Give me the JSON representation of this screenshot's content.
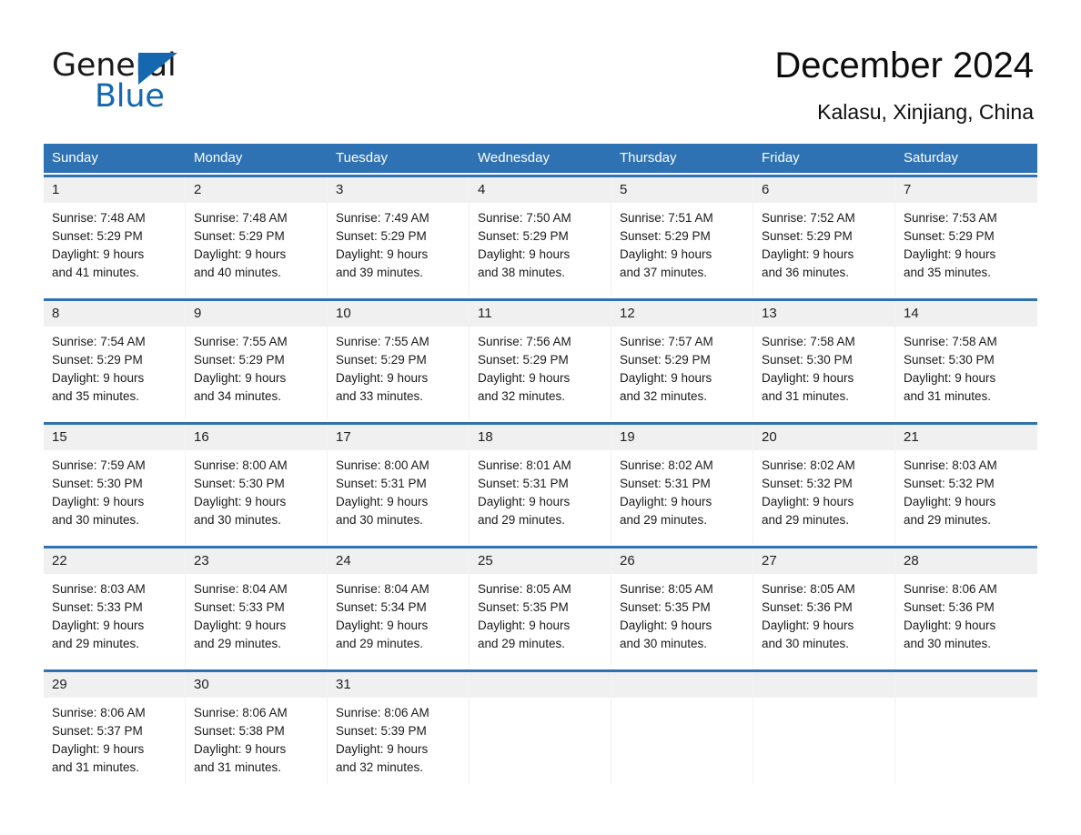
{
  "brand": {
    "name_part1": "General",
    "name_part2": "Blue",
    "logo_icon": "triangle-logo-icon"
  },
  "header": {
    "title": "December 2024",
    "location": "Kalasu, Xinjiang, China"
  },
  "colors": {
    "header_blue": "#2f72b3",
    "brand_blue": "#1567b0",
    "day_band": "#f0f0f0",
    "text": "#1a1a1a"
  },
  "weekdays": [
    "Sunday",
    "Monday",
    "Tuesday",
    "Wednesday",
    "Thursday",
    "Friday",
    "Saturday"
  ],
  "weeks": [
    {
      "days": [
        {
          "date": "1",
          "sunrise": "Sunrise: 7:48 AM",
          "sunset": "Sunset: 5:29 PM",
          "daylight_line1": "Daylight: 9 hours",
          "daylight_line2": "and 41 minutes."
        },
        {
          "date": "2",
          "sunrise": "Sunrise: 7:48 AM",
          "sunset": "Sunset: 5:29 PM",
          "daylight_line1": "Daylight: 9 hours",
          "daylight_line2": "and 40 minutes."
        },
        {
          "date": "3",
          "sunrise": "Sunrise: 7:49 AM",
          "sunset": "Sunset: 5:29 PM",
          "daylight_line1": "Daylight: 9 hours",
          "daylight_line2": "and 39 minutes."
        },
        {
          "date": "4",
          "sunrise": "Sunrise: 7:50 AM",
          "sunset": "Sunset: 5:29 PM",
          "daylight_line1": "Daylight: 9 hours",
          "daylight_line2": "and 38 minutes."
        },
        {
          "date": "5",
          "sunrise": "Sunrise: 7:51 AM",
          "sunset": "Sunset: 5:29 PM",
          "daylight_line1": "Daylight: 9 hours",
          "daylight_line2": "and 37 minutes."
        },
        {
          "date": "6",
          "sunrise": "Sunrise: 7:52 AM",
          "sunset": "Sunset: 5:29 PM",
          "daylight_line1": "Daylight: 9 hours",
          "daylight_line2": "and 36 minutes."
        },
        {
          "date": "7",
          "sunrise": "Sunrise: 7:53 AM",
          "sunset": "Sunset: 5:29 PM",
          "daylight_line1": "Daylight: 9 hours",
          "daylight_line2": "and 35 minutes."
        }
      ]
    },
    {
      "days": [
        {
          "date": "8",
          "sunrise": "Sunrise: 7:54 AM",
          "sunset": "Sunset: 5:29 PM",
          "daylight_line1": "Daylight: 9 hours",
          "daylight_line2": "and 35 minutes."
        },
        {
          "date": "9",
          "sunrise": "Sunrise: 7:55 AM",
          "sunset": "Sunset: 5:29 PM",
          "daylight_line1": "Daylight: 9 hours",
          "daylight_line2": "and 34 minutes."
        },
        {
          "date": "10",
          "sunrise": "Sunrise: 7:55 AM",
          "sunset": "Sunset: 5:29 PM",
          "daylight_line1": "Daylight: 9 hours",
          "daylight_line2": "and 33 minutes."
        },
        {
          "date": "11",
          "sunrise": "Sunrise: 7:56 AM",
          "sunset": "Sunset: 5:29 PM",
          "daylight_line1": "Daylight: 9 hours",
          "daylight_line2": "and 32 minutes."
        },
        {
          "date": "12",
          "sunrise": "Sunrise: 7:57 AM",
          "sunset": "Sunset: 5:29 PM",
          "daylight_line1": "Daylight: 9 hours",
          "daylight_line2": "and 32 minutes."
        },
        {
          "date": "13",
          "sunrise": "Sunrise: 7:58 AM",
          "sunset": "Sunset: 5:30 PM",
          "daylight_line1": "Daylight: 9 hours",
          "daylight_line2": "and 31 minutes."
        },
        {
          "date": "14",
          "sunrise": "Sunrise: 7:58 AM",
          "sunset": "Sunset: 5:30 PM",
          "daylight_line1": "Daylight: 9 hours",
          "daylight_line2": "and 31 minutes."
        }
      ]
    },
    {
      "days": [
        {
          "date": "15",
          "sunrise": "Sunrise: 7:59 AM",
          "sunset": "Sunset: 5:30 PM",
          "daylight_line1": "Daylight: 9 hours",
          "daylight_line2": "and 30 minutes."
        },
        {
          "date": "16",
          "sunrise": "Sunrise: 8:00 AM",
          "sunset": "Sunset: 5:30 PM",
          "daylight_line1": "Daylight: 9 hours",
          "daylight_line2": "and 30 minutes."
        },
        {
          "date": "17",
          "sunrise": "Sunrise: 8:00 AM",
          "sunset": "Sunset: 5:31 PM",
          "daylight_line1": "Daylight: 9 hours",
          "daylight_line2": "and 30 minutes."
        },
        {
          "date": "18",
          "sunrise": "Sunrise: 8:01 AM",
          "sunset": "Sunset: 5:31 PM",
          "daylight_line1": "Daylight: 9 hours",
          "daylight_line2": "and 29 minutes."
        },
        {
          "date": "19",
          "sunrise": "Sunrise: 8:02 AM",
          "sunset": "Sunset: 5:31 PM",
          "daylight_line1": "Daylight: 9 hours",
          "daylight_line2": "and 29 minutes."
        },
        {
          "date": "20",
          "sunrise": "Sunrise: 8:02 AM",
          "sunset": "Sunset: 5:32 PM",
          "daylight_line1": "Daylight: 9 hours",
          "daylight_line2": "and 29 minutes."
        },
        {
          "date": "21",
          "sunrise": "Sunrise: 8:03 AM",
          "sunset": "Sunset: 5:32 PM",
          "daylight_line1": "Daylight: 9 hours",
          "daylight_line2": "and 29 minutes."
        }
      ]
    },
    {
      "days": [
        {
          "date": "22",
          "sunrise": "Sunrise: 8:03 AM",
          "sunset": "Sunset: 5:33 PM",
          "daylight_line1": "Daylight: 9 hours",
          "daylight_line2": "and 29 minutes."
        },
        {
          "date": "23",
          "sunrise": "Sunrise: 8:04 AM",
          "sunset": "Sunset: 5:33 PM",
          "daylight_line1": "Daylight: 9 hours",
          "daylight_line2": "and 29 minutes."
        },
        {
          "date": "24",
          "sunrise": "Sunrise: 8:04 AM",
          "sunset": "Sunset: 5:34 PM",
          "daylight_line1": "Daylight: 9 hours",
          "daylight_line2": "and 29 minutes."
        },
        {
          "date": "25",
          "sunrise": "Sunrise: 8:05 AM",
          "sunset": "Sunset: 5:35 PM",
          "daylight_line1": "Daylight: 9 hours",
          "daylight_line2": "and 29 minutes."
        },
        {
          "date": "26",
          "sunrise": "Sunrise: 8:05 AM",
          "sunset": "Sunset: 5:35 PM",
          "daylight_line1": "Daylight: 9 hours",
          "daylight_line2": "and 30 minutes."
        },
        {
          "date": "27",
          "sunrise": "Sunrise: 8:05 AM",
          "sunset": "Sunset: 5:36 PM",
          "daylight_line1": "Daylight: 9 hours",
          "daylight_line2": "and 30 minutes."
        },
        {
          "date": "28",
          "sunrise": "Sunrise: 8:06 AM",
          "sunset": "Sunset: 5:36 PM",
          "daylight_line1": "Daylight: 9 hours",
          "daylight_line2": "and 30 minutes."
        }
      ]
    },
    {
      "days": [
        {
          "date": "29",
          "sunrise": "Sunrise: 8:06 AM",
          "sunset": "Sunset: 5:37 PM",
          "daylight_line1": "Daylight: 9 hours",
          "daylight_line2": "and 31 minutes."
        },
        {
          "date": "30",
          "sunrise": "Sunrise: 8:06 AM",
          "sunset": "Sunset: 5:38 PM",
          "daylight_line1": "Daylight: 9 hours",
          "daylight_line2": "and 31 minutes."
        },
        {
          "date": "31",
          "sunrise": "Sunrise: 8:06 AM",
          "sunset": "Sunset: 5:39 PM",
          "daylight_line1": "Daylight: 9 hours",
          "daylight_line2": "and 32 minutes."
        },
        {
          "date": "",
          "sunrise": "",
          "sunset": "",
          "daylight_line1": "",
          "daylight_line2": ""
        },
        {
          "date": "",
          "sunrise": "",
          "sunset": "",
          "daylight_line1": "",
          "daylight_line2": ""
        },
        {
          "date": "",
          "sunrise": "",
          "sunset": "",
          "daylight_line1": "",
          "daylight_line2": ""
        },
        {
          "date": "",
          "sunrise": "",
          "sunset": "",
          "daylight_line1": "",
          "daylight_line2": ""
        }
      ]
    }
  ]
}
